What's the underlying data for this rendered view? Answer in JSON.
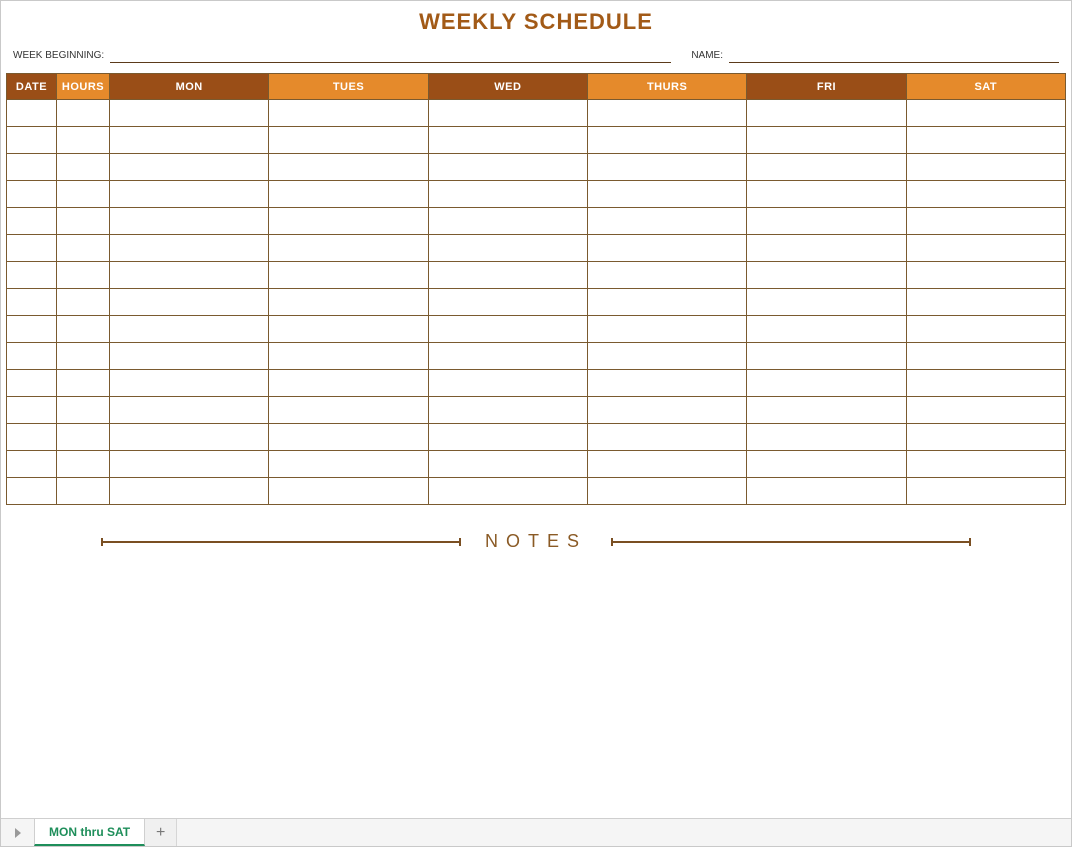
{
  "title": "WEEKLY SCHEDULE",
  "fields": {
    "week_beginning_label": "WEEK BEGINNING:",
    "name_label": "NAME:"
  },
  "columns": [
    {
      "label": "DATE",
      "shade": "dark",
      "class": "col-date"
    },
    {
      "label": "HOURS",
      "shade": "light",
      "class": "col-hours"
    },
    {
      "label": "MON",
      "shade": "dark",
      "class": "col-day"
    },
    {
      "label": "TUES",
      "shade": "light",
      "class": "col-day"
    },
    {
      "label": "WED",
      "shade": "dark",
      "class": "col-day"
    },
    {
      "label": "THURS",
      "shade": "light",
      "class": "col-day"
    },
    {
      "label": "FRI",
      "shade": "dark",
      "class": "col-day"
    },
    {
      "label": "SAT",
      "shade": "light",
      "class": "col-day"
    }
  ],
  "row_count": 15,
  "notes_label": "NOTES",
  "sheet_tab": "MON thru SAT"
}
